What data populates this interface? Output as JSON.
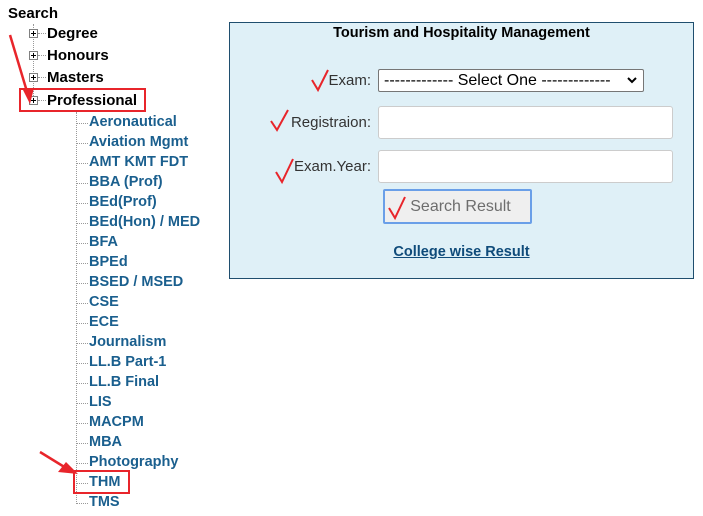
{
  "tree": {
    "root_label": "Search",
    "top_items": [
      {
        "label": "Degree",
        "expand_icon": "plus-box-icon"
      },
      {
        "label": "Honours",
        "expand_icon": "plus-box-icon"
      },
      {
        "label": "Masters",
        "expand_icon": "plus-box-icon"
      },
      {
        "label": "Professional",
        "expand_icon": "plus-box-icon"
      }
    ],
    "professional_children": [
      "Aeronautical",
      "Aviation Mgmt",
      "AMT KMT FDT",
      "BBA (Prof)",
      "BEd(Prof)",
      "BEd(Hon) / MED",
      "BFA",
      "BPEd",
      "BSED / MSED",
      "CSE",
      "ECE",
      "Journalism",
      "LL.B Part-1",
      "LL.B Final",
      "LIS",
      "MACPM",
      "MBA",
      "Photography",
      "THM",
      "TMS"
    ]
  },
  "form": {
    "title": "Tourism and Hospitality Management",
    "exam_label": "Exam:",
    "exam_select_value": "------------- Select One -------------",
    "registration_label": "Registraion:",
    "registration_value": "",
    "exam_year_label": "Exam.Year:",
    "exam_year_value": "",
    "search_button": "Search Result",
    "college_link": "College wise Result"
  },
  "annotations": {
    "color": "#e8252b",
    "highlighted": [
      "Professional",
      "THM"
    ],
    "checkmark_icon": "checkmark-icon",
    "arrow_icon": "arrow-icon"
  },
  "colors": {
    "panel_bg": "#dff0f7",
    "panel_border": "#1f4e6e",
    "link_color": "#1a5f8e"
  }
}
